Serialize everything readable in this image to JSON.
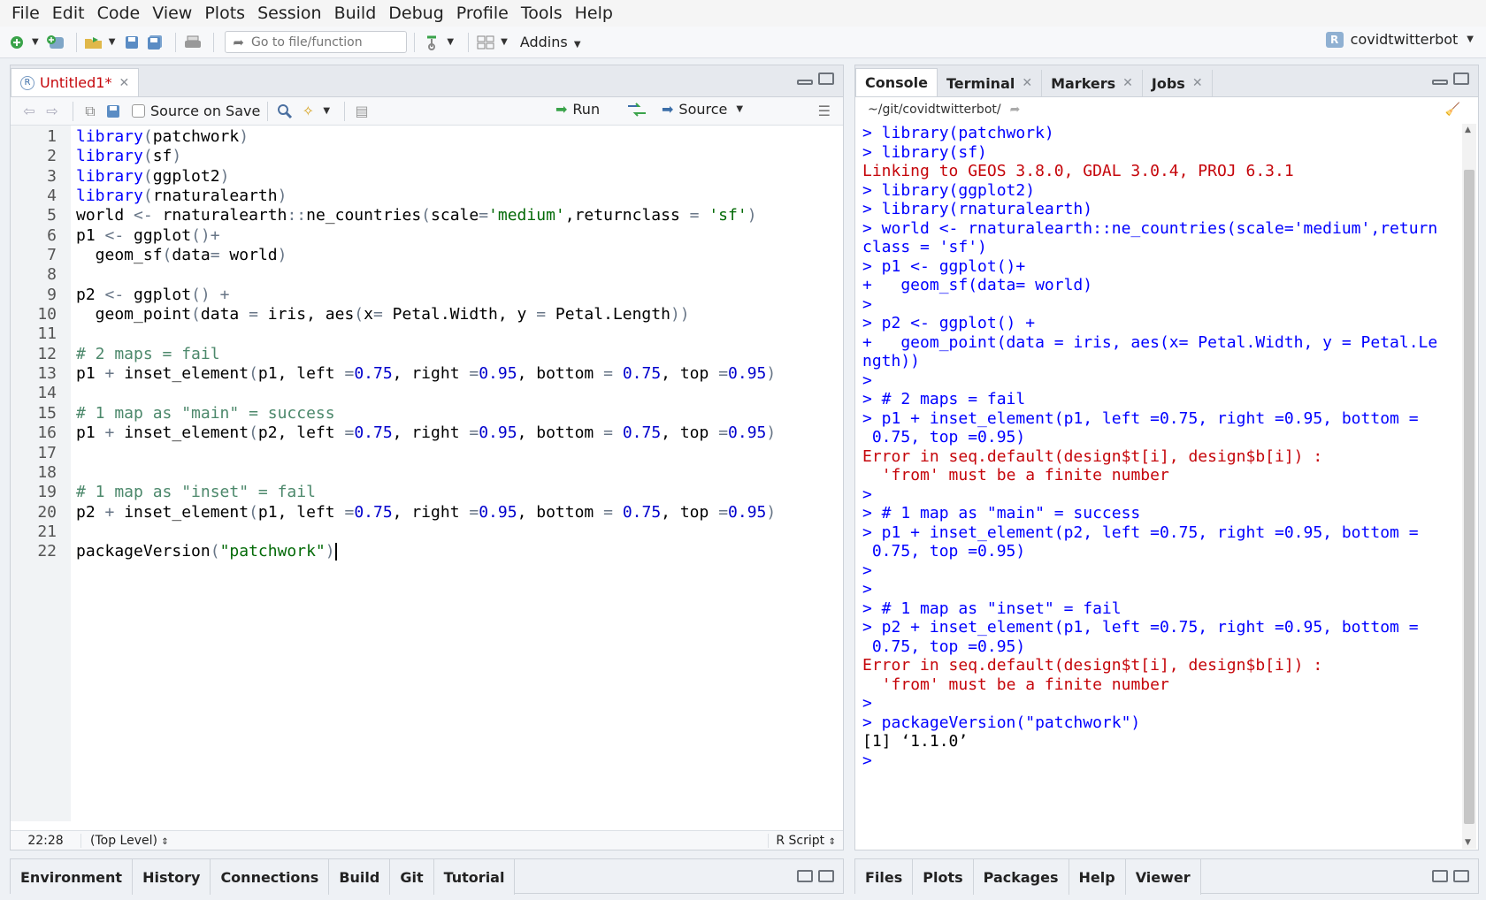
{
  "menu": [
    "File",
    "Edit",
    "Code",
    "View",
    "Plots",
    "Session",
    "Build",
    "Debug",
    "Profile",
    "Tools",
    "Help"
  ],
  "toolbar": {
    "goto_placeholder": "Go to file/function",
    "addins_label": "Addins",
    "project_name": "covidtwitterbot"
  },
  "editor": {
    "tab_label": "Untitled1*",
    "source_on_save_label": "Source on Save",
    "run_label": "Run",
    "source_label": "Source",
    "line_numbers": [
      "1",
      "2",
      "3",
      "4",
      "5",
      "6",
      "7",
      "8",
      "9",
      "10",
      "11",
      "12",
      "13",
      "14",
      "15",
      "16",
      "17",
      "18",
      "19",
      "20",
      "21",
      "22"
    ],
    "cursor_pos": "22:28",
    "scope": "(Top Level)",
    "file_type": "R Script"
  },
  "code_lines": [
    "library(patchwork)",
    "library(sf)",
    "library(ggplot2)",
    "library(rnaturalearth)",
    "world <- rnaturalearth::ne_countries(scale='medium',returnclass = 'sf')",
    "p1 <- ggplot()+",
    "  geom_sf(data= world)",
    "",
    "p2 <- ggplot() +",
    "  geom_point(data = iris, aes(x= Petal.Width, y = Petal.Length))",
    "",
    "# 2 maps = fail",
    "p1 + inset_element(p1, left =0.75, right =0.95, bottom = 0.75, top =0.95)",
    "",
    "# 1 map as \"main\" = success",
    "p1 + inset_element(p2, left =0.75, right =0.95, bottom = 0.75, top =0.95)",
    "",
    "",
    "# 1 map as \"inset\" = fail",
    "p2 + inset_element(p1, left =0.75, right =0.95, bottom = 0.75, top =0.95)",
    "",
    "packageVersion(\"patchwork\")"
  ],
  "console": {
    "tabs": [
      "Console",
      "Terminal",
      "Markers",
      "Jobs"
    ],
    "path": "~/git/covidtwitterbot/",
    "lines": [
      {
        "t": "in",
        "s": "> library(patchwork)"
      },
      {
        "t": "in",
        "s": "> library(sf)"
      },
      {
        "t": "err",
        "s": "Linking to GEOS 3.8.0, GDAL 3.0.4, PROJ 6.3.1"
      },
      {
        "t": "in",
        "s": "> library(ggplot2)"
      },
      {
        "t": "in",
        "s": "> library(rnaturalearth)"
      },
      {
        "t": "in",
        "s": "> world <- rnaturalearth::ne_countries(scale='medium',return"
      },
      {
        "t": "in",
        "s": "class = 'sf')"
      },
      {
        "t": "in",
        "s": "> p1 <- ggplot()+"
      },
      {
        "t": "in",
        "s": "+   geom_sf(data= world)"
      },
      {
        "t": "in",
        "s": ">"
      },
      {
        "t": "in",
        "s": "> p2 <- ggplot() +"
      },
      {
        "t": "in",
        "s": "+   geom_point(data = iris, aes(x= Petal.Width, y = Petal.Le"
      },
      {
        "t": "in",
        "s": "ngth))"
      },
      {
        "t": "in",
        "s": ">"
      },
      {
        "t": "in",
        "s": "> # 2 maps = fail"
      },
      {
        "t": "in",
        "s": "> p1 + inset_element(p1, left =0.75, right =0.95, bottom ="
      },
      {
        "t": "in",
        "s": " 0.75, top =0.95)"
      },
      {
        "t": "err",
        "s": "Error in seq.default(design$t[i], design$b[i]) :"
      },
      {
        "t": "err",
        "s": "  'from' must be a finite number"
      },
      {
        "t": "in",
        "s": ">"
      },
      {
        "t": "in",
        "s": "> # 1 map as \"main\" = success"
      },
      {
        "t": "in",
        "s": "> p1 + inset_element(p2, left =0.75, right =0.95, bottom ="
      },
      {
        "t": "in",
        "s": " 0.75, top =0.95)"
      },
      {
        "t": "in",
        "s": ">"
      },
      {
        "t": "in",
        "s": ">"
      },
      {
        "t": "in",
        "s": "> # 1 map as \"inset\" = fail"
      },
      {
        "t": "in",
        "s": "> p2 + inset_element(p1, left =0.75, right =0.95, bottom ="
      },
      {
        "t": "in",
        "s": " 0.75, top =0.95)"
      },
      {
        "t": "err",
        "s": "Error in seq.default(design$t[i], design$b[i]) :"
      },
      {
        "t": "err",
        "s": "  'from' must be a finite number"
      },
      {
        "t": "in",
        "s": ">"
      },
      {
        "t": "in",
        "s": "> packageVersion(\"patchwork\")"
      },
      {
        "t": "out",
        "s": "[1] ‘1.1.0’"
      },
      {
        "t": "in",
        "s": "> "
      }
    ]
  },
  "env_tabs": [
    "Environment",
    "History",
    "Connections",
    "Build",
    "Git",
    "Tutorial"
  ],
  "files_tabs": [
    "Files",
    "Plots",
    "Packages",
    "Help",
    "Viewer"
  ]
}
